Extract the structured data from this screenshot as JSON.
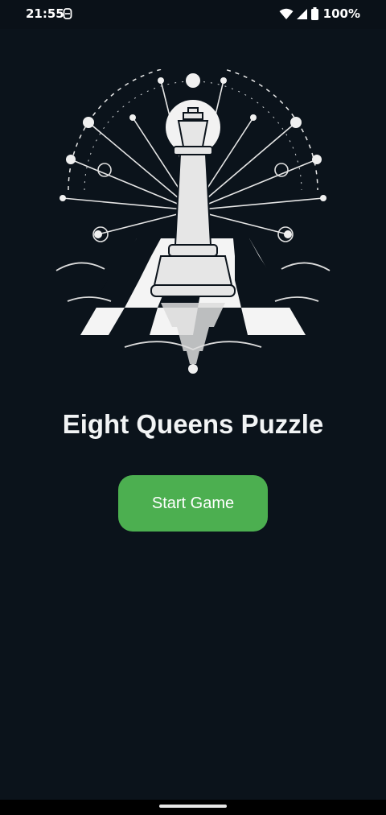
{
  "status_bar": {
    "time": "21:55",
    "battery": "100%"
  },
  "app": {
    "title": "Eight Queens Puzzle",
    "start_button_label": "Start Game"
  },
  "colors": {
    "background": "#0b131b",
    "button": "#4caf50",
    "text": "#ffffff"
  },
  "icons": [
    "wifi-icon",
    "signal-icon",
    "battery-icon",
    "chess-king-logo"
  ]
}
